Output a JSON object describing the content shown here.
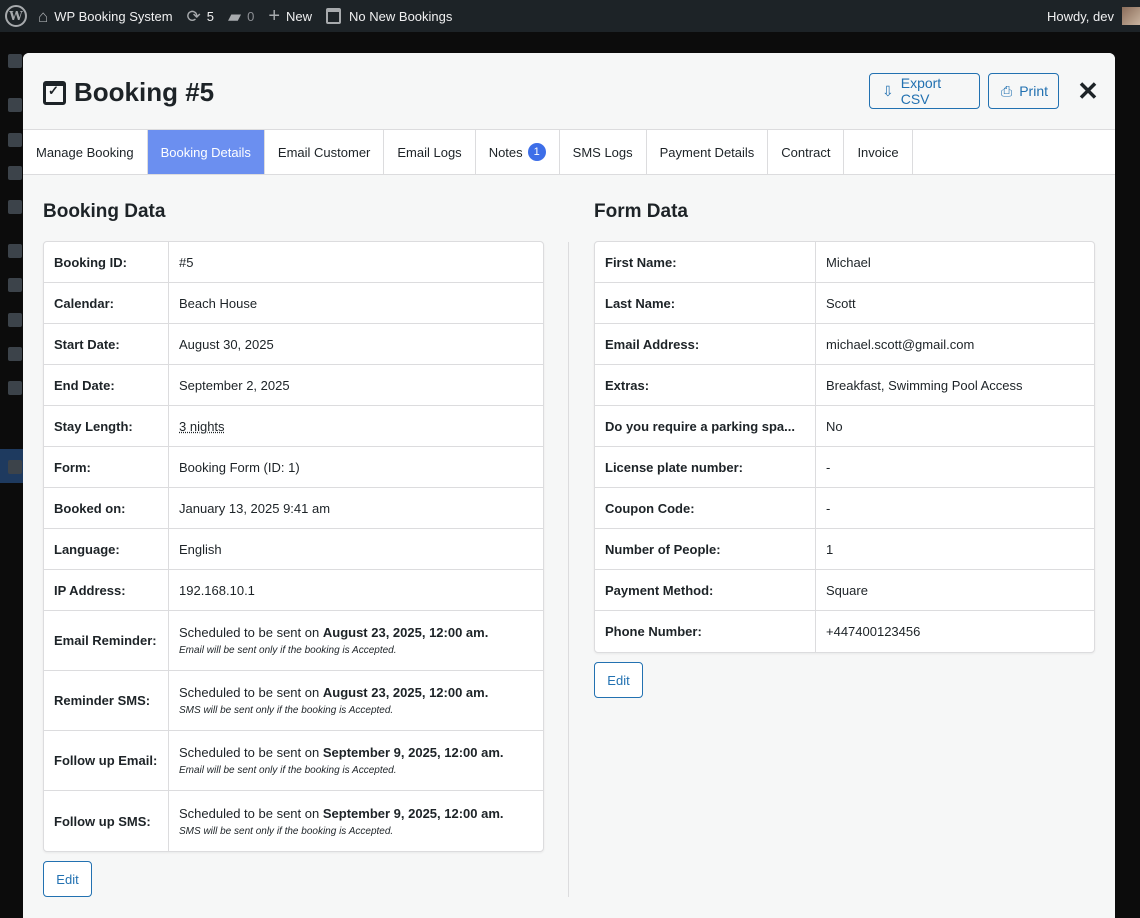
{
  "adminbar": {
    "site_name": "WP Booking System",
    "updates_count": "5",
    "comments_count": "0",
    "new_label": "New",
    "bookings_label": "No New Bookings",
    "howdy": "Howdy, dev"
  },
  "modal": {
    "title": "Booking #5",
    "export_label": "Export CSV",
    "print_label": "Print",
    "close_glyph": "✕"
  },
  "tabs": [
    {
      "label": "Manage Booking",
      "active": false
    },
    {
      "label": "Booking Details",
      "active": true
    },
    {
      "label": "Email Customer",
      "active": false
    },
    {
      "label": "Email Logs",
      "active": false
    },
    {
      "label": "Notes",
      "active": false,
      "badge": "1"
    },
    {
      "label": "SMS Logs",
      "active": false
    },
    {
      "label": "Payment Details",
      "active": false
    },
    {
      "label": "Contract",
      "active": false
    },
    {
      "label": "Invoice",
      "active": false
    }
  ],
  "booking_data": {
    "title": "Booking Data",
    "rows": [
      {
        "label": "Booking ID:",
        "value": "#5"
      },
      {
        "label": "Calendar:",
        "value": "Beach House"
      },
      {
        "label": "Start Date:",
        "value": "August 30, 2025"
      },
      {
        "label": "End Date:",
        "value": "September 2, 2025"
      },
      {
        "label": "Stay Length:",
        "value": "3 nights"
      },
      {
        "label": "Form:",
        "value": "Booking Form (ID: 1)"
      },
      {
        "label": "Booked on:",
        "value": "January 13, 2025 9:41 am"
      },
      {
        "label": "Language:",
        "value": "English"
      },
      {
        "label": "IP Address:",
        "value": "192.168.10.1"
      }
    ],
    "scheduled_rows": [
      {
        "label": "Email Reminder:",
        "prefix": "Scheduled to be sent on",
        "date": "August 23, 2025, 12:00 am.",
        "note": "Email will be sent only if the booking is Accepted."
      },
      {
        "label": "Reminder SMS:",
        "prefix": "Scheduled to be sent on",
        "date": "August 23, 2025, 12:00 am.",
        "note": "SMS will be sent only if the booking is Accepted."
      },
      {
        "label": "Follow up Email:",
        "prefix": "Scheduled to be sent on",
        "date": "September 9, 2025, 12:00 am.",
        "note": "Email will be sent only if the booking is Accepted."
      },
      {
        "label": "Follow up SMS:",
        "prefix": "Scheduled to be sent on",
        "date": "September 9, 2025, 12:00 am.",
        "note": "SMS will be sent only if the booking is Accepted."
      }
    ],
    "edit_label": "Edit"
  },
  "form_data": {
    "title": "Form Data",
    "rows": [
      {
        "label": "First Name:",
        "value": "Michael"
      },
      {
        "label": "Last Name:",
        "value": "Scott"
      },
      {
        "label": "Email Address:",
        "value": "michael.scott@gmail.com"
      },
      {
        "label": "Extras:",
        "value": "Breakfast, Swimming Pool Access"
      },
      {
        "label": "Do you require a parking spa...",
        "value": "No"
      },
      {
        "label": "License plate number:",
        "value": "-"
      },
      {
        "label": "Coupon Code:",
        "value": "-"
      },
      {
        "label": "Number of People:",
        "value": "1"
      },
      {
        "label": "Payment Method:",
        "value": "Square"
      },
      {
        "label": "Phone Number:",
        "value": "+447400123456"
      }
    ],
    "edit_label": "Edit"
  }
}
